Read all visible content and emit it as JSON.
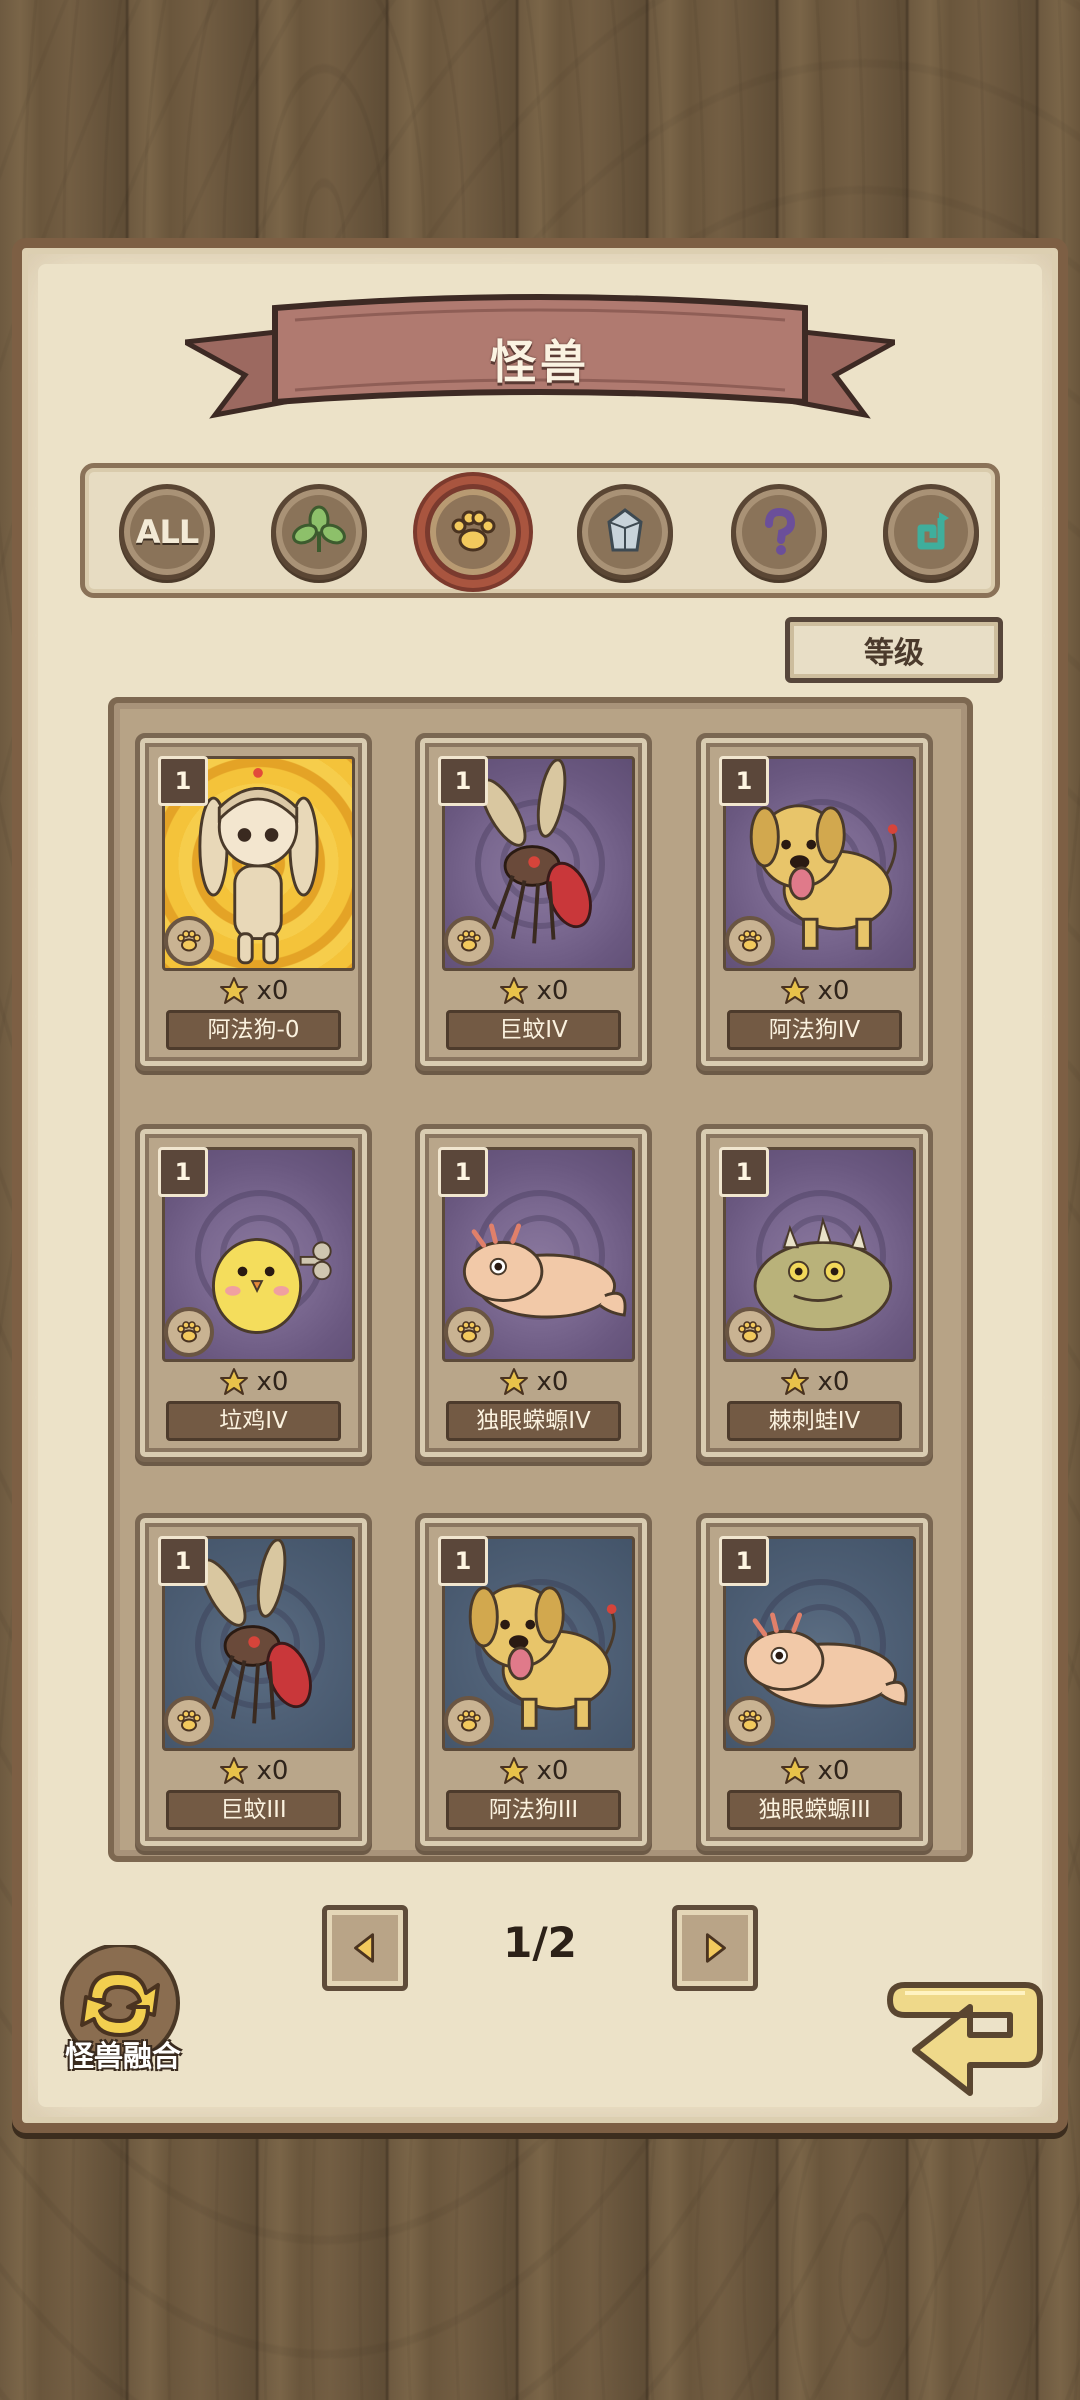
{
  "header": {
    "title": "怪兽"
  },
  "categories": [
    {
      "id": "all",
      "label": "ALL",
      "icon": "all-icon",
      "active": false
    },
    {
      "id": "plant",
      "icon": "leaf-icon",
      "active": false
    },
    {
      "id": "beast",
      "icon": "paw-icon",
      "active": true
    },
    {
      "id": "mineral",
      "icon": "crystal-icon",
      "active": false
    },
    {
      "id": "unknown",
      "icon": "question-icon",
      "active": false
    },
    {
      "id": "mechanical",
      "icon": "gear-icon",
      "active": false
    }
  ],
  "sort": {
    "label": "等级"
  },
  "cards": [
    {
      "name": "阿法狗-0",
      "level": "1",
      "count": "x0",
      "bg": "gold",
      "monster": "girl"
    },
    {
      "name": "巨蚊IV",
      "level": "1",
      "count": "x0",
      "bg": "purple",
      "monster": "mosquito"
    },
    {
      "name": "阿法狗IV",
      "level": "1",
      "count": "x0",
      "bg": "purple",
      "monster": "dog"
    },
    {
      "name": "垃鸡IV",
      "level": "1",
      "count": "x0",
      "bg": "purple",
      "monster": "chick"
    },
    {
      "name": "独眼蝾螈IV",
      "level": "1",
      "count": "x0",
      "bg": "purple",
      "monster": "axolotl"
    },
    {
      "name": "棘刺蛙IV",
      "level": "1",
      "count": "x0",
      "bg": "purple",
      "monster": "frog"
    },
    {
      "name": "巨蚊III",
      "level": "1",
      "count": "x0",
      "bg": "blue",
      "monster": "mosquito"
    },
    {
      "name": "阿法狗III",
      "level": "1",
      "count": "x0",
      "bg": "blue",
      "monster": "dog"
    },
    {
      "name": "独眼蝾螈III",
      "level": "1",
      "count": "x0",
      "bg": "blue",
      "monster": "axolotl"
    }
  ],
  "pagination": {
    "current": "1/2"
  },
  "fusion": {
    "label": "怪兽融合"
  },
  "colors": {
    "ribbon": "#a9746a",
    "gold_bg": "#f4c33a",
    "purple_bg": "#7a6890",
    "blue_bg": "#4f6076"
  }
}
